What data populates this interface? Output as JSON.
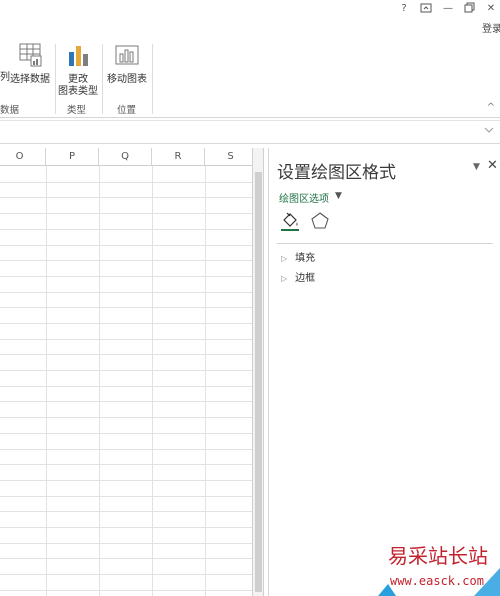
{
  "window": {
    "help": "?",
    "restore_ribbon": "⧉",
    "minimize": "—",
    "maximize": "⧉",
    "close": "✕",
    "login": "登录"
  },
  "ribbon": {
    "partial_button": "列",
    "select_data": "选择数据",
    "group_data_label": "数据",
    "change_type_line1": "更改",
    "change_type_line2": "图表类型",
    "group_type_label": "类型",
    "move_chart": "移动图表",
    "group_location_label": "位置",
    "collapse": "^"
  },
  "grid": {
    "columns": [
      "O",
      "P",
      "Q",
      "R",
      "S"
    ]
  },
  "format_pane": {
    "title": "设置绘图区格式",
    "pin": "▼",
    "close": "✕",
    "options_label": "绘图区选项",
    "options_caret": "▼",
    "sections": [
      {
        "label": "填充"
      },
      {
        "label": "边框"
      }
    ]
  },
  "watermark": {
    "text": "易采站长站",
    "url": "www.easck.com"
  },
  "colors": {
    "accent_green": "#217346",
    "watermark_red": "#c3222e"
  }
}
